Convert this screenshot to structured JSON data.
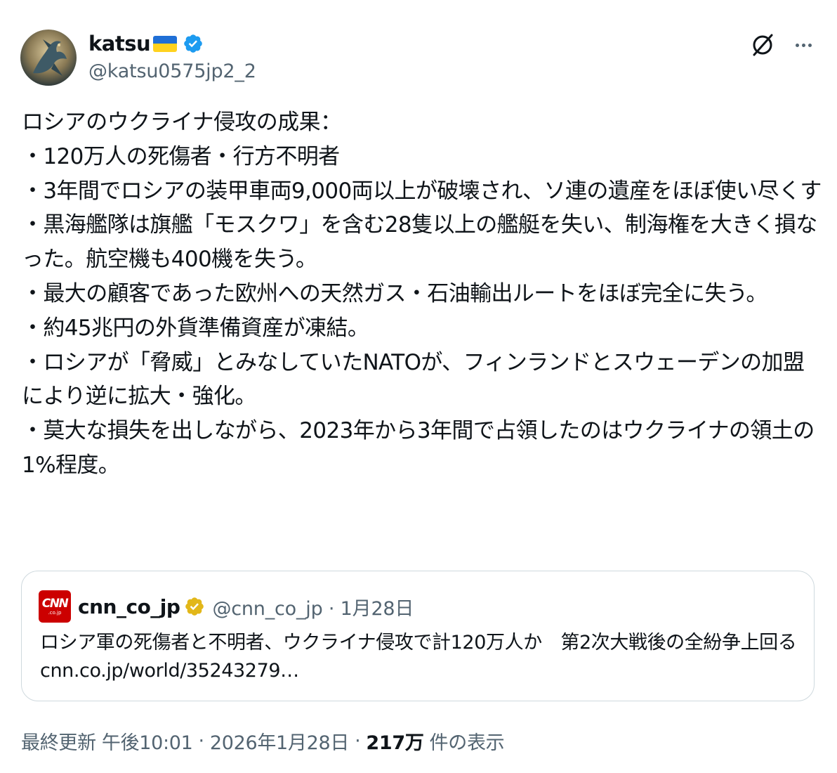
{
  "author": {
    "display_name": "katsu",
    "handle": "@katsu0575jp2_2",
    "flag_colors": {
      "top": "#1f6fd6",
      "bottom": "#ffd21f"
    },
    "badge_color": "#1d9bf0"
  },
  "header_icons": {
    "grok": "grok-icon",
    "more": "more-icon"
  },
  "tweet_text": "ロシアのウクライナ侵攻の成果：\n・120万人の死傷者・行方不明者\n・3年間でロシアの装甲車両9,000両以上が破壊され、ソ連の遺産をほぼ使い尽くす\n・黒海艦隊は旗艦「モスクワ」を含む28隻以上の艦艇を失い、制海権を大きく損なった。航空機も400機を失う。\n・最大の顧客であった欧州への天然ガス・石油輸出ルートをほぼ完全に失う。\n・約45兆円の外貨準備資産が凍結。\n・ロシアが「脅威」とみなしていたNATOが、フィンランドとスウェーデンの加盟により逆に拡大・強化。\n・莫大な損失を出しながら、2023年から3年間で占領したのはウクライナの領土の1%程度。",
  "quote": {
    "logo_text": "CNN",
    "logo_sub": ".co.jp",
    "name": "cnn_co_jp",
    "meta": "@cnn_co_jp · 1月28日",
    "text": "ロシア軍の死傷者と不明者、ウクライナ侵攻で計120万人か　第2次大戦後の全紛争上回る cnn.co.jp/world/35243279…",
    "badge_color": "#e2b719",
    "logo_color": "#cc0000"
  },
  "footer": {
    "updated_label": "最終更新",
    "time": "午後10:01",
    "separator": "·",
    "date": "2026年1月28日",
    "views_count": "217万",
    "views_label": "件の表示"
  }
}
